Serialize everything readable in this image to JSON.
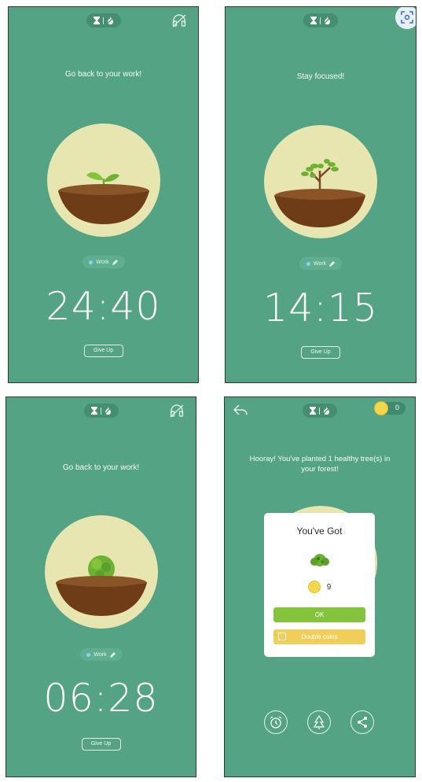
{
  "panels": [
    {
      "message": "Go back to your work!",
      "tag": "Work",
      "timer": "24:40",
      "button": "Give Up"
    },
    {
      "message": "Stay focused!",
      "tag": "Work",
      "timer": "14:15",
      "button": "Give Up"
    },
    {
      "message": "Go back to your work!",
      "tag": "Work",
      "timer": "06:28",
      "button": "Give Up"
    }
  ],
  "result": {
    "coins": "0",
    "message": "Hooray! You've planted 1 healthy tree(s) in your forest!",
    "dialog_title": "You've Got",
    "reward_amount": "9",
    "ok_label": "OK",
    "double_label": "Double coins"
  },
  "icons": {
    "mode_toggle": [
      "hourglass-icon",
      "flame-icon"
    ],
    "corner": "headphones-icon",
    "scan": "scan-icon",
    "back": "back-arrow-icon",
    "bottom": [
      "alarm-clock-icon",
      "forest-icon",
      "share-icon"
    ]
  },
  "colors": {
    "background": "#54a385",
    "soil_circle": "#e8e6b0",
    "soil": "#6e3c16",
    "ok": "#84c43c",
    "double": "#f1cd5a",
    "coin": "#f4d64b"
  }
}
